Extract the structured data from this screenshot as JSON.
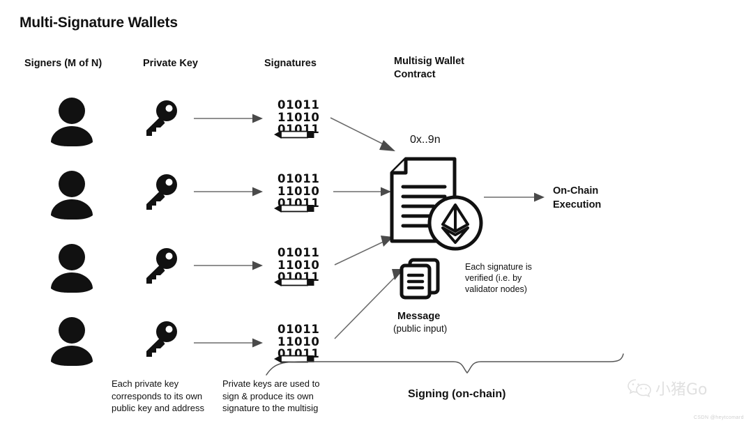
{
  "title": "Multi-Signature Wallets",
  "columns": {
    "signers": "Signers (M of N)",
    "private_key": "Private Key",
    "signatures": "Signatures",
    "multisig_contract": "Multisig Wallet Contract"
  },
  "signature_rows": [
    {
      "line1": "01011",
      "line2": "11010",
      "line3": "01011"
    },
    {
      "line1": "01011",
      "line2": "11010",
      "line3": "01011"
    },
    {
      "line1": "01011",
      "line2": "11010",
      "line3": "01011"
    },
    {
      "line1": "01011",
      "line2": "11010",
      "line3": "01011"
    }
  ],
  "contract": {
    "address": "0x..9n"
  },
  "message": {
    "label": "Message",
    "sublabel": "(public input)"
  },
  "notes": {
    "verify": "Each signature is verified (i.e. by validator nodes)",
    "private_key_note": "Each private key corresponds to its own public key and address",
    "signing_note": "Private keys are used to sign & produce its own signature to the multisig"
  },
  "brace_label": "Signing (on-chain)",
  "execution": {
    "line1": "On-Chain",
    "line2": "Execution"
  },
  "watermark": {
    "text": "小猪Go",
    "credit": "CSDN @heytcomard"
  },
  "colors": {
    "ink": "#111111",
    "arrow": "#6b6b6b",
    "brace": "#555555",
    "watermark": "#9a9a9a"
  },
  "icons": {
    "person": "person-icon",
    "key": "key-icon",
    "pencil": "pencil-icon",
    "document": "contract-document-icon",
    "ethereum": "ethereum-logo-icon",
    "message": "message-stack-icon",
    "wechat": "wechat-logo-icon"
  }
}
